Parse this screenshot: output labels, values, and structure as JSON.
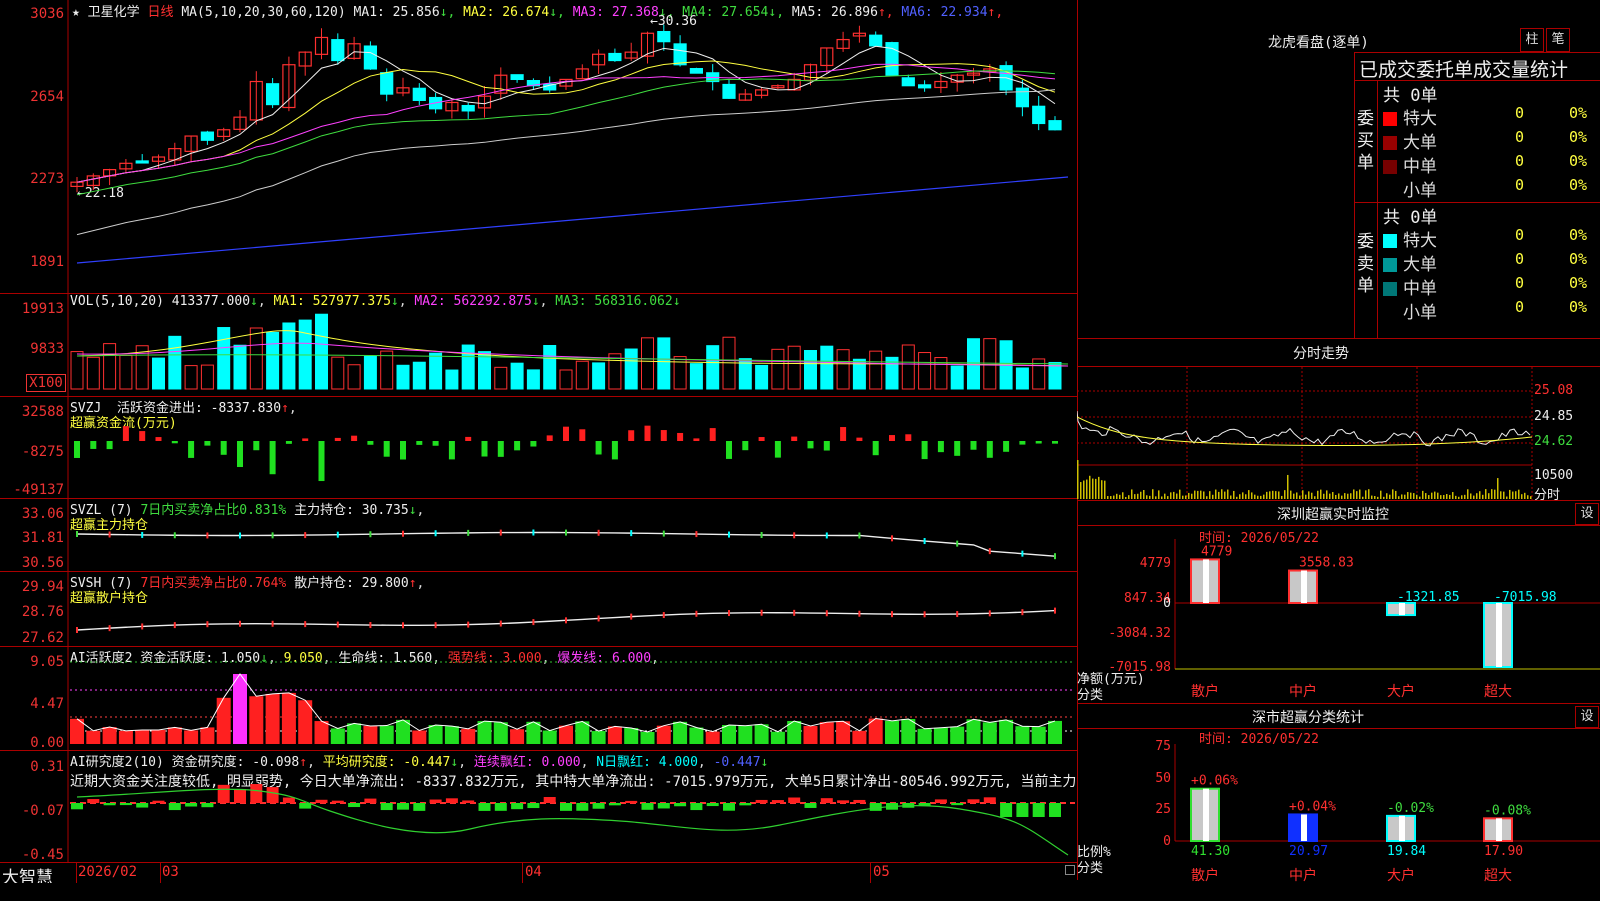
{
  "stock": {
    "name": "卫星化学",
    "period": "日线",
    "star": "★"
  },
  "kline": {
    "ma_header": "MA(5,10,20,30,60,120)",
    "mas": [
      {
        "label": "MA1: 25.856",
        "arrow": "↓",
        "color": "#eeeeee"
      },
      {
        "label": "MA2: 26.674",
        "arrow": "↓",
        "color": "#ffff40"
      },
      {
        "label": "MA3: 27.368",
        "arrow": "↓",
        "color": "#ff40ff"
      },
      {
        "label": "MA4: 27.654",
        "arrow": "↓",
        "color": "#3fdc3f"
      },
      {
        "label": "MA5: 26.896",
        "arrow": "↑",
        "color": "#eeeeee"
      },
      {
        "label": "MA6: 22.934",
        "arrow": "↑",
        "color": "#5060ff"
      }
    ],
    "y_labels": [
      "3036",
      "2654",
      "2273",
      "1891"
    ],
    "high_marker": "30.36",
    "low_marker": "22.18",
    "up_color": "#ff3030",
    "down_color": "#00ffff"
  },
  "volume": {
    "header": "VOL(5,10,20)",
    "value": "413377.000",
    "ma1": "MA1: 527977.375",
    "ma2": "MA2: 562292.875",
    "ma3": "MA3: 568316.062",
    "y_labels": [
      "19913",
      "9833"
    ],
    "unit": "X100"
  },
  "svzj": {
    "header": "SVZJ",
    "text": "活跃资金进出: -8337.830",
    "arrow": "↑",
    "subtitle": "超赢资金流(万元)",
    "y_labels": [
      "32588",
      "-8275",
      "-49137"
    ]
  },
  "svzl": {
    "header": "SVZL (7)",
    "text1": "7日内买卖净占比0.831%",
    "text2": "主力持仓: 30.735",
    "arrow": "↓",
    "subtitle": "超赢主力持仓",
    "y_labels": [
      "33.06",
      "31.81",
      "30.56"
    ]
  },
  "svsh": {
    "header": "SVSH (7)",
    "text1": "7日内买卖净占比0.764%",
    "text2": "散户持仓: 29.800",
    "arrow": "↑",
    "subtitle": "超赢散户持仓",
    "y_labels": [
      "29.94",
      "28.76",
      "27.62"
    ]
  },
  "ai_active": {
    "header": "AI活跃度2",
    "t1": "资金活跃度: 1.050",
    "t2": "9.050",
    "t3": "生命线: 1.560",
    "t4": "强势线: 3.000",
    "t5": "爆发线: 6.000",
    "y_labels": [
      "9.05",
      "4.47",
      "0.00"
    ]
  },
  "ai_research": {
    "header": "AI研究度2(10)",
    "t1": "资金研究度: -0.098",
    "t2": "平均研究度: -0.447",
    "t3": "连续飘红: 0.000",
    "t4": "N日飘红: 4.000",
    "t5": "-0.447",
    "comment": "近期大资金关注度较低, 明显弱势, 今日大单净流出: -8337.832万元, 其中特大单净流出: -7015.979万元, 大单5日累计净出-80546.992万元, 当前主力",
    "y_labels": [
      "0.31",
      "-0.07",
      "-0.45"
    ]
  },
  "bottom_bar": {
    "brand": "大智慧",
    "dates": [
      "2026/02",
      "03",
      "04",
      "05"
    ]
  },
  "right": {
    "dragon_title": "龙虎看盘(逐单)",
    "tab_zhu": "柱",
    "tab_bi": "笔",
    "stats_title": "已成交委托单成交量统计",
    "buy_label": "委买单",
    "sell_label": "委卖单",
    "buy_total": "共 0单",
    "sell_total": "共 0单",
    "buy_rows": [
      {
        "name": "特大",
        "count": "0",
        "pct": "0%",
        "color": "#ff0000"
      },
      {
        "name": "大单",
        "count": "0",
        "pct": "0%",
        "color": "#990000"
      },
      {
        "name": "中单",
        "count": "0",
        "pct": "0%",
        "color": "#770000"
      },
      {
        "name": "小单",
        "count": "0",
        "pct": "0%",
        "color": "#000000"
      }
    ],
    "sell_rows": [
      {
        "name": "特大",
        "count": "0",
        "pct": "0%",
        "color": "#00ffff"
      },
      {
        "name": "大单",
        "count": "0",
        "pct": "0%",
        "color": "#009999"
      },
      {
        "name": "中单",
        "count": "0",
        "pct": "0%",
        "color": "#007777"
      },
      {
        "name": "小单",
        "count": "0",
        "pct": "0%",
        "color": "#000000"
      }
    ],
    "intraday_title": "分时走势",
    "intraday_prices": [
      "25.08",
      "24.85",
      "24.62"
    ],
    "intraday_vol": "10500",
    "intraday_unit": "分时",
    "monitor_title": "深圳超赢实时监控",
    "monitor_set": "设",
    "monitor_time": "时间: 2026/05/22",
    "monitor_y": [
      "4779",
      "847.34",
      "0",
      "-3084.32",
      "-7015.98"
    ],
    "monitor_unit1": "净额(万元)",
    "monitor_unit2": "分类",
    "monitor_bars": [
      {
        "cat": "散户",
        "value": "4779"
      },
      {
        "cat": "中户",
        "value": "3558.83"
      },
      {
        "cat": "大户",
        "value": "-1321.85"
      },
      {
        "cat": "超大",
        "value": "-7015.98"
      }
    ],
    "class_title": "深市超赢分类统计",
    "class_set": "设",
    "class_time": "时间: 2026/05/22",
    "class_y": [
      "75",
      "50",
      "25",
      "0"
    ],
    "class_unit1": "比例%",
    "class_unit2": "分类",
    "class_bars": [
      {
        "cat": "散户",
        "value": "41.30",
        "delta": "+0.06%"
      },
      {
        "cat": "中户",
        "value": "20.97",
        "delta": "+0.04%"
      },
      {
        "cat": "大户",
        "value": "19.84",
        "delta": "-0.02%"
      },
      {
        "cat": "超大",
        "value": "17.90",
        "delta": "-0.08%"
      }
    ]
  }
}
